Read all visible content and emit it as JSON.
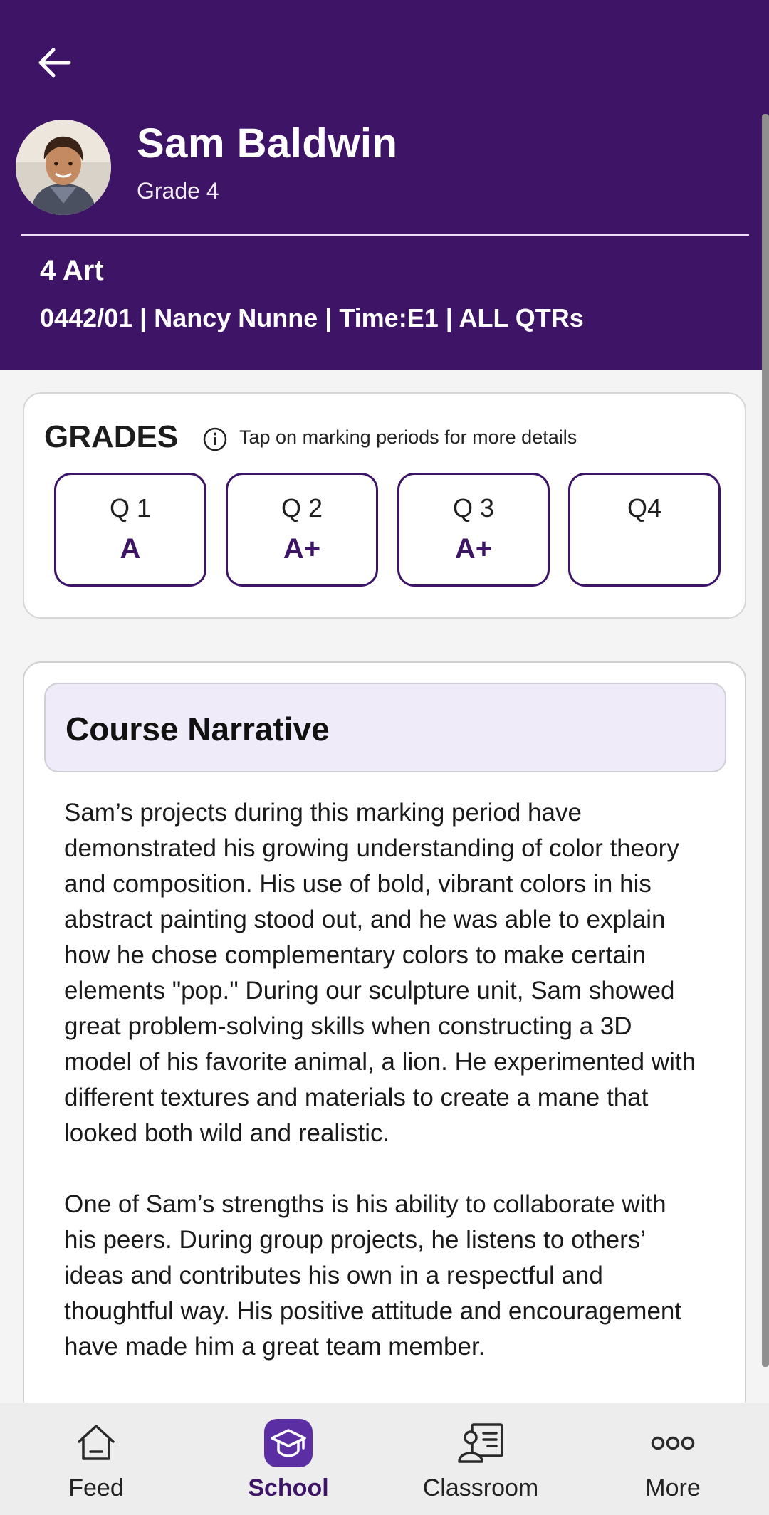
{
  "header": {
    "back_icon": "arrow-left-icon",
    "student_name": "Sam Baldwin",
    "student_grade": "Grade 4",
    "course_title": "4 Art",
    "course_meta": "0442/01 | Nancy Nunne | Time:E1 | ALL QTRs"
  },
  "grades": {
    "title": "GRADES",
    "hint": "Tap on marking periods for more details",
    "quarters": [
      {
        "label": "Q 1",
        "grade": "A"
      },
      {
        "label": "Q 2",
        "grade": "A+"
      },
      {
        "label": "Q 3",
        "grade": "A+"
      },
      {
        "label": "Q4",
        "grade": ""
      }
    ]
  },
  "narrative": {
    "title": "Course Narrative",
    "paragraphs": [
      "Sam’s projects during this marking period have demonstrated his growing understanding of color theory and composition. His use of bold, vibrant colors in his abstract painting stood out, and he was able to explain how he chose complementary colors to make certain elements \"pop.\" During our sculpture unit, Sam showed great problem-solving skills when constructing a 3D model of his favorite animal, a lion. He experimented with different textures and materials to create a mane that looked both wild and realistic.",
      "One of Sam’s strengths is his ability to collaborate with his peers. During group projects, he listens to others’ ideas and contributes his own in a respectful and thoughtful way. His positive attitude and encouragement have made him a great team member."
    ]
  },
  "bottom_nav": {
    "items": [
      {
        "label": "Feed",
        "icon": "home-icon"
      },
      {
        "label": "School",
        "icon": "graduation-cap-icon"
      },
      {
        "label": "Classroom",
        "icon": "classroom-icon"
      },
      {
        "label": "More",
        "icon": "more-dots-icon"
      }
    ],
    "active": "School"
  },
  "colors": {
    "brand": "#3d1466",
    "accent": "#5b2fa3",
    "narrative_header_bg": "#efebf8"
  }
}
